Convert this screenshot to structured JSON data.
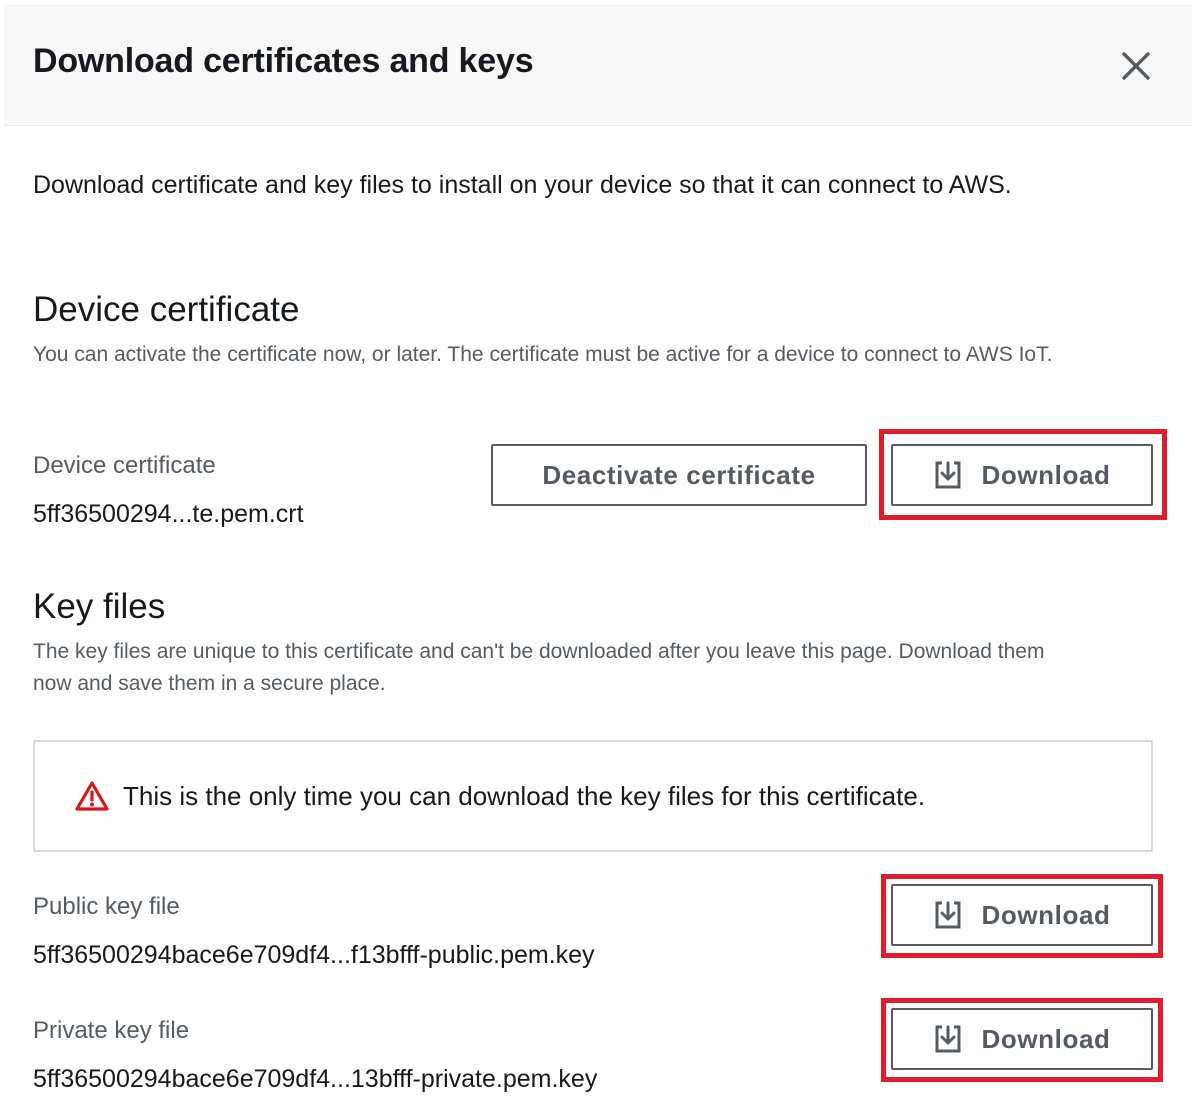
{
  "modal": {
    "title": "Download certificates and keys",
    "close_icon": "close-icon",
    "intro": "Download certificate and key files to install on your device so that it can connect to AWS."
  },
  "device_certificate": {
    "section_title": "Device certificate",
    "description": "You can activate the certificate now, or later. The certificate must be active for a device to connect to AWS IoT.",
    "label": "Device certificate",
    "filename": "5ff36500294...te.pem.crt",
    "deactivate_label": "Deactivate certificate",
    "download_label": "Download"
  },
  "key_files": {
    "section_title": "Key files",
    "description": "The key files are unique to this certificate and can't be downloaded after you leave this page. Download them now and save them in a secure place.",
    "warning": "This is the only time you can download the key files for this certificate.",
    "warning_icon": "warning-icon",
    "public_label": "Public key file",
    "public_filename": "5ff36500294bace6e709df4...f13bfff-public.pem.key",
    "public_download_label": "Download",
    "private_label": "Private key file",
    "private_filename": "5ff36500294bace6e709df4...13bfff-private.pem.key",
    "private_download_label": "Download"
  },
  "colors": {
    "highlight": "#e11d2b",
    "warning": "#d91515",
    "button_border": "#545b64",
    "header_bg": "#f8f8f8"
  }
}
